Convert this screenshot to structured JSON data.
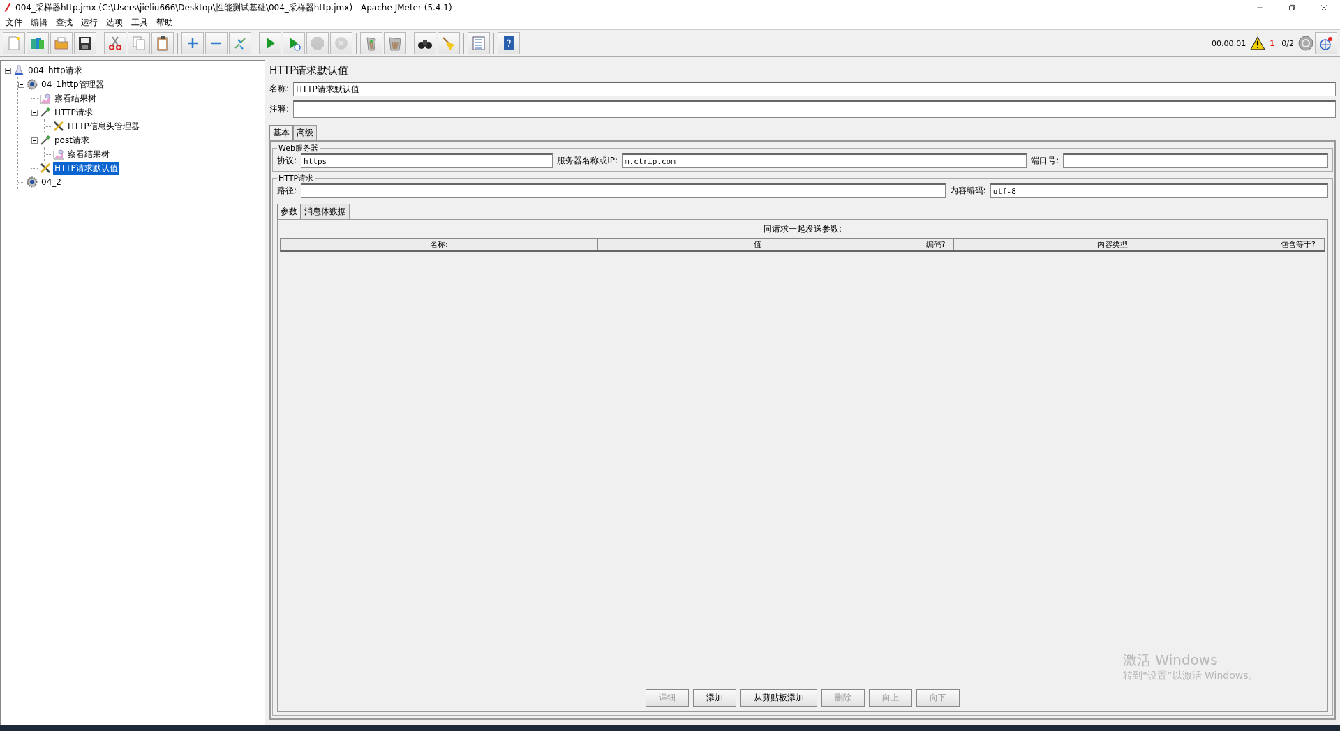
{
  "window": {
    "title": "004_采样器http.jmx (C:\\Users\\jieliu666\\Desktop\\性能测试基础\\004_采样器http.jmx) - Apache JMeter (5.4.1)"
  },
  "menu": [
    "文件",
    "编辑",
    "查找",
    "运行",
    "选项",
    "工具",
    "帮助"
  ],
  "toolbar": [
    {
      "kind": "new",
      "disabled": false
    },
    {
      "kind": "templates",
      "disabled": false
    },
    {
      "kind": "open",
      "disabled": false
    },
    {
      "kind": "save",
      "disabled": false,
      "group_end": true
    },
    {
      "kind": "cut",
      "disabled": false
    },
    {
      "kind": "copy",
      "disabled": false
    },
    {
      "kind": "paste",
      "disabled": false,
      "group_end": true
    },
    {
      "kind": "expand",
      "disabled": false
    },
    {
      "kind": "collapse",
      "disabled": false
    },
    {
      "kind": "toggle",
      "disabled": false,
      "group_end": true
    },
    {
      "kind": "start",
      "disabled": false
    },
    {
      "kind": "start-no-timers",
      "disabled": false
    },
    {
      "kind": "stop",
      "disabled": true
    },
    {
      "kind": "shutdown",
      "disabled": true,
      "group_end": true
    },
    {
      "kind": "clear",
      "disabled": false
    },
    {
      "kind": "clear-all",
      "disabled": false,
      "group_end": true
    },
    {
      "kind": "search",
      "disabled": false
    },
    {
      "kind": "reset-search",
      "disabled": false,
      "group_end": true
    },
    {
      "kind": "function-helper",
      "disabled": false,
      "group_end": true
    },
    {
      "kind": "help",
      "disabled": false
    }
  ],
  "status": {
    "elapsed": "00:00:01",
    "warnings": "1",
    "threads": "0/2"
  },
  "tree": [
    {
      "label": "004_http请求",
      "kind": "testplan",
      "selected": false,
      "expanded": true,
      "children": [
        {
          "label": "04_1http管理器",
          "kind": "threadgroup",
          "selected": false,
          "expanded": true,
          "children": [
            {
              "label": "察看结果树",
              "kind": "listener",
              "selected": false
            },
            {
              "label": "HTTP请求",
              "kind": "sampler",
              "selected": false,
              "expanded": true,
              "children": [
                {
                  "label": "HTTP信息头管理器",
                  "kind": "config",
                  "selected": false
                }
              ]
            },
            {
              "label": "post请求",
              "kind": "sampler",
              "selected": false,
              "expanded": true,
              "children": [
                {
                  "label": "察看结果树",
                  "kind": "listener",
                  "selected": false
                }
              ]
            },
            {
              "label": "HTTP请求默认值",
              "kind": "config",
              "selected": true
            }
          ]
        },
        {
          "label": "04_2",
          "kind": "threadgroup",
          "selected": false
        }
      ]
    }
  ],
  "panel": {
    "title": "HTTP请求默认值",
    "name_label": "名称:",
    "name_value": "HTTP请求默认值",
    "comment_label": "注释:",
    "tabs": [
      {
        "label": "基本",
        "selected": true
      },
      {
        "label": "高级",
        "selected": false
      }
    ],
    "web_server": {
      "title": "Web服务器",
      "protocol_label": "协议:",
      "protocol_value": "https",
      "server_label": "服务器名称或IP:",
      "server_value": "m.ctrip.com",
      "port_label": "端口号:"
    },
    "http_request": {
      "title": "HTTP请求",
      "path_label": "路径:",
      "encoding_label": "内容编码:",
      "encoding_value": "utf-8"
    },
    "sub_tabs": [
      {
        "label": "参数",
        "selected": true
      },
      {
        "label": "消息体数据",
        "selected": false
      }
    ],
    "table": {
      "caption": "同请求一起发送参数:",
      "columns": [
        "名称:",
        "值",
        "编码?",
        "内容类型",
        "包含等于?"
      ]
    },
    "buttons": [
      {
        "label": "详细",
        "disabled": true
      },
      {
        "label": "添加",
        "disabled": false
      },
      {
        "label": "从剪贴板添加",
        "disabled": false
      },
      {
        "label": "删除",
        "disabled": true
      },
      {
        "label": "向上",
        "disabled": true
      },
      {
        "label": "向下",
        "disabled": true
      }
    ]
  },
  "activation_notice": {
    "title": "激活 Windows",
    "text": "转到“设置”以激活 Windows。"
  }
}
